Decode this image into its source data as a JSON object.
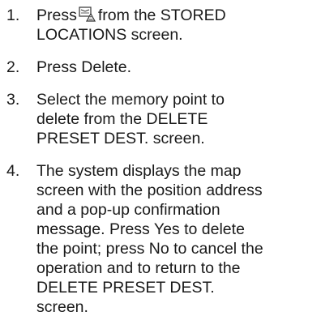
{
  "steps": [
    {
      "number": "1.",
      "before_icon": "Press",
      "icon": "map-destination-icon",
      "after_icon": "from the STORED\nLOCATIONS screen."
    },
    {
      "number": "2.",
      "text": "Press Delete."
    },
    {
      "number": "3.",
      "text": "Select the memory point to\ndelete from the DELETE\nPRESET DEST. screen."
    },
    {
      "number": "4.",
      "text": "The system displays the map\nscreen with the position address\nand a pop-up confirmation\nmessage. Press Yes to delete\nthe point; press No to cancel the\noperation and to return to the\nDELETE PRESET DEST.\nscreen."
    }
  ]
}
